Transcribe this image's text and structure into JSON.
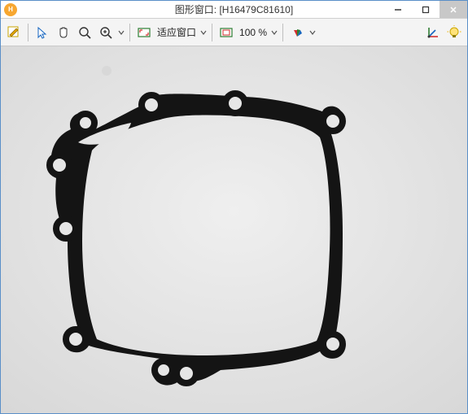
{
  "window": {
    "title": "图形窗口: [H16479C81610]"
  },
  "toolbar": {
    "fit_label": "适应窗口",
    "zoom_label": "100 %"
  },
  "colors": {
    "accent_orange": "#f7a731",
    "border_blue": "#5a8fc8"
  }
}
